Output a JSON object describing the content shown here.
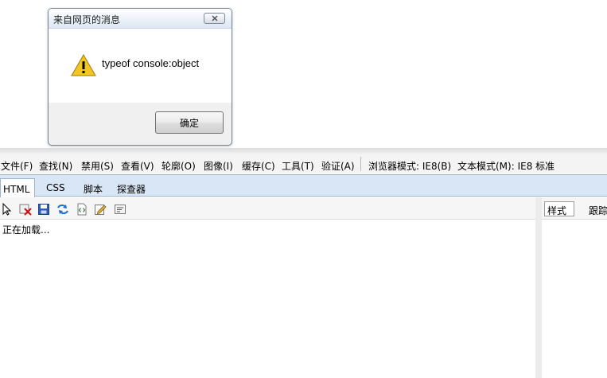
{
  "dialog": {
    "title": "来自网页的消息",
    "message": "typeof console:object",
    "ok_label": "确定",
    "icon": "warning-icon"
  },
  "menubar": {
    "items": [
      {
        "label": "文件(F)"
      },
      {
        "label": "查找(N)"
      },
      {
        "label": "禁用(S)"
      },
      {
        "label": "查看(V)"
      },
      {
        "label": "轮廓(O)"
      },
      {
        "label": "图像(I)"
      },
      {
        "label": "缓存(C)"
      },
      {
        "label": "工具(T)"
      },
      {
        "label": "验证(A)"
      }
    ],
    "browser_mode": "浏览器模式: IE8(B)",
    "document_mode": "文本模式(M):  IE8 标准"
  },
  "tabs": [
    {
      "label": "HTML",
      "active": true
    },
    {
      "label": "CSS"
    },
    {
      "label": "脚本"
    },
    {
      "label": "探查器"
    }
  ],
  "toolbar": {
    "icons": [
      "select-pointer-icon",
      "clear-icon",
      "save-icon",
      "refresh-icon",
      "source-icon",
      "edit-icon",
      "word-wrap-icon"
    ]
  },
  "html_pane": {
    "loading_text": "正在加载..."
  },
  "right_panel": {
    "tabs": [
      {
        "label": "样式",
        "active": true
      },
      {
        "label": "跟踪"
      }
    ]
  },
  "colors": {
    "tab_bar": "#d9e6f5",
    "warning_yellow": "#f3c623"
  }
}
